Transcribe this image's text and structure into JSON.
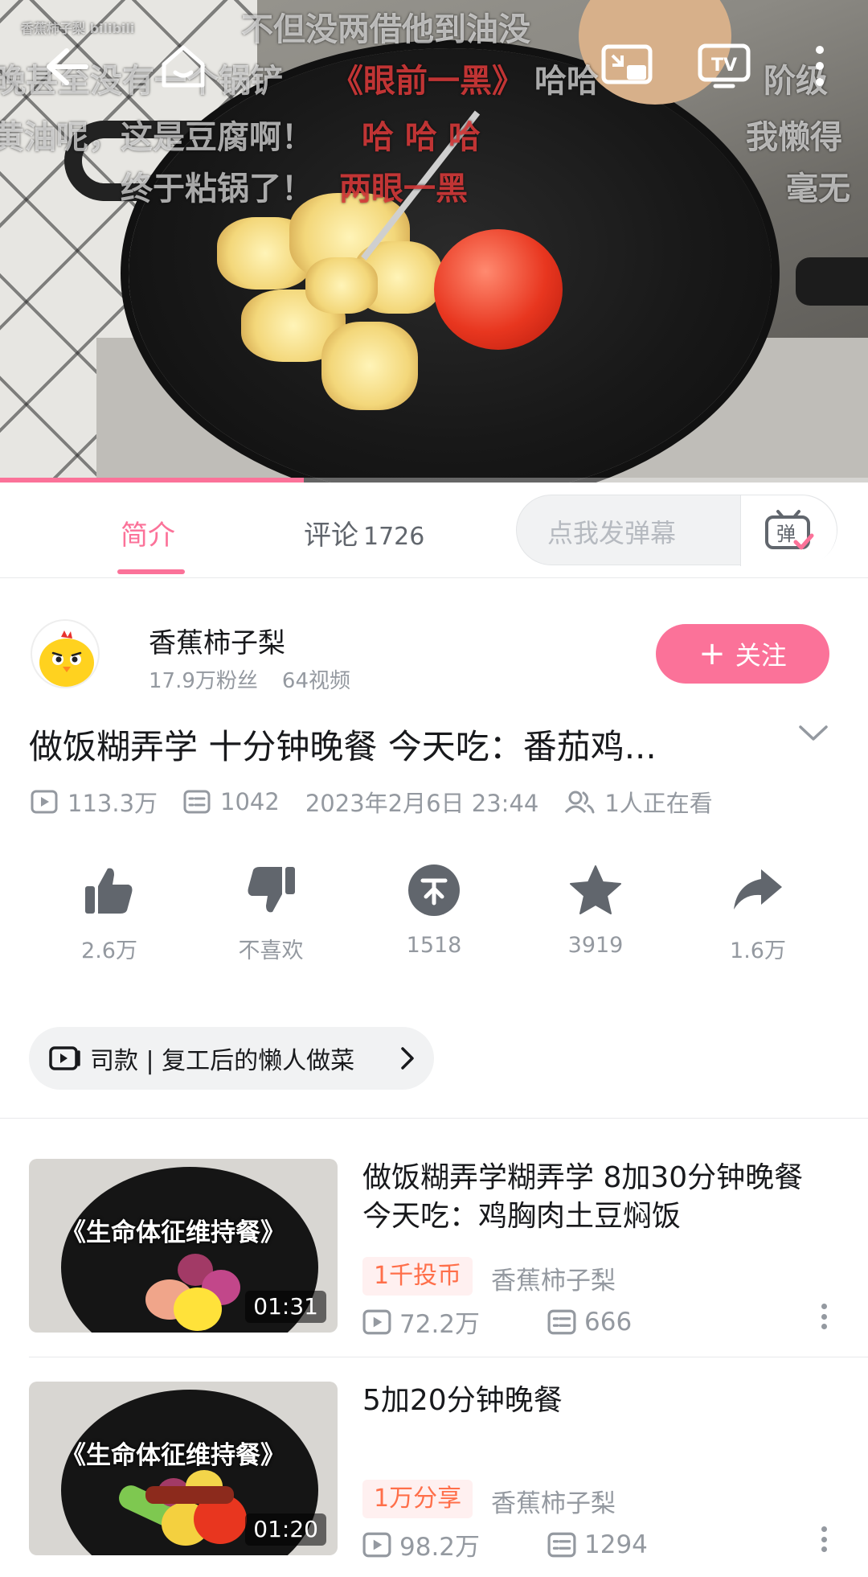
{
  "player": {
    "danmaku": [
      "不但没两借他到油没",
      "晚甚至没有一个锅铲",
      "《眼前一黑》",
      "哈哈",
      "阶级",
      "黄油呢，这是豆腐啊！",
      "哈 哈 哈",
      "我懒得",
      "终于粘锅了！",
      "两眼一黑",
      "毫无",
      "香蕉柿子梨 bilibili"
    ],
    "progress": 0.35,
    "buttons": [
      "back-icon",
      "home-icon",
      "pip-icon",
      "tv-cast-icon",
      "more-icon"
    ]
  },
  "tabs": {
    "intro": "简介",
    "comments": "评论",
    "comments_count": "1726",
    "danmaku_placeholder": "点我发弹幕",
    "danmaku_button_glyph": "弹"
  },
  "uploader": {
    "name": "香蕉柿子梨",
    "fans": "17.9万粉丝",
    "videos": "64视频",
    "follow_label": "关注",
    "follow_plus": "+"
  },
  "video": {
    "title": "做饭糊弄学 十分钟晚餐 今天吃：番茄鸡...",
    "views": "113.3万",
    "danmaku": "1042",
    "date": "2023年2月6日 23:44",
    "watching": "1人正在看"
  },
  "actions": [
    {
      "icon": "thumb-up-icon",
      "label": "2.6万"
    },
    {
      "icon": "thumb-down-icon",
      "label": "不喜欢"
    },
    {
      "icon": "coin-icon",
      "label": "1518"
    },
    {
      "icon": "star-icon",
      "label": "3919"
    },
    {
      "icon": "share-icon",
      "label": "1.6万"
    }
  ],
  "collection": {
    "text": "司款 | 复工后的懒人做菜"
  },
  "recommendations": [
    {
      "title": "做饭糊弄学糊弄学 8加30分钟晚餐 今天吃：鸡胸肉土豆焖饭",
      "thumb_text": "《生命体征维持餐》",
      "duration": "01:31",
      "badge": "1千投币",
      "uploader": "香蕉柿子梨",
      "views": "72.2万",
      "danmaku": "666"
    },
    {
      "title": "5加20分钟晚餐",
      "thumb_text": "《生命体征维持餐》",
      "duration": "01:20",
      "badge": "1万分享",
      "uploader": "香蕉柿子梨",
      "views": "98.2万",
      "danmaku": "1294"
    }
  ],
  "colors": {
    "accent": "#fb7299",
    "muted": "#9499a0",
    "text": "#18191c",
    "badge_bg": "#fff0f0",
    "badge_text": "#ff6f4a"
  }
}
